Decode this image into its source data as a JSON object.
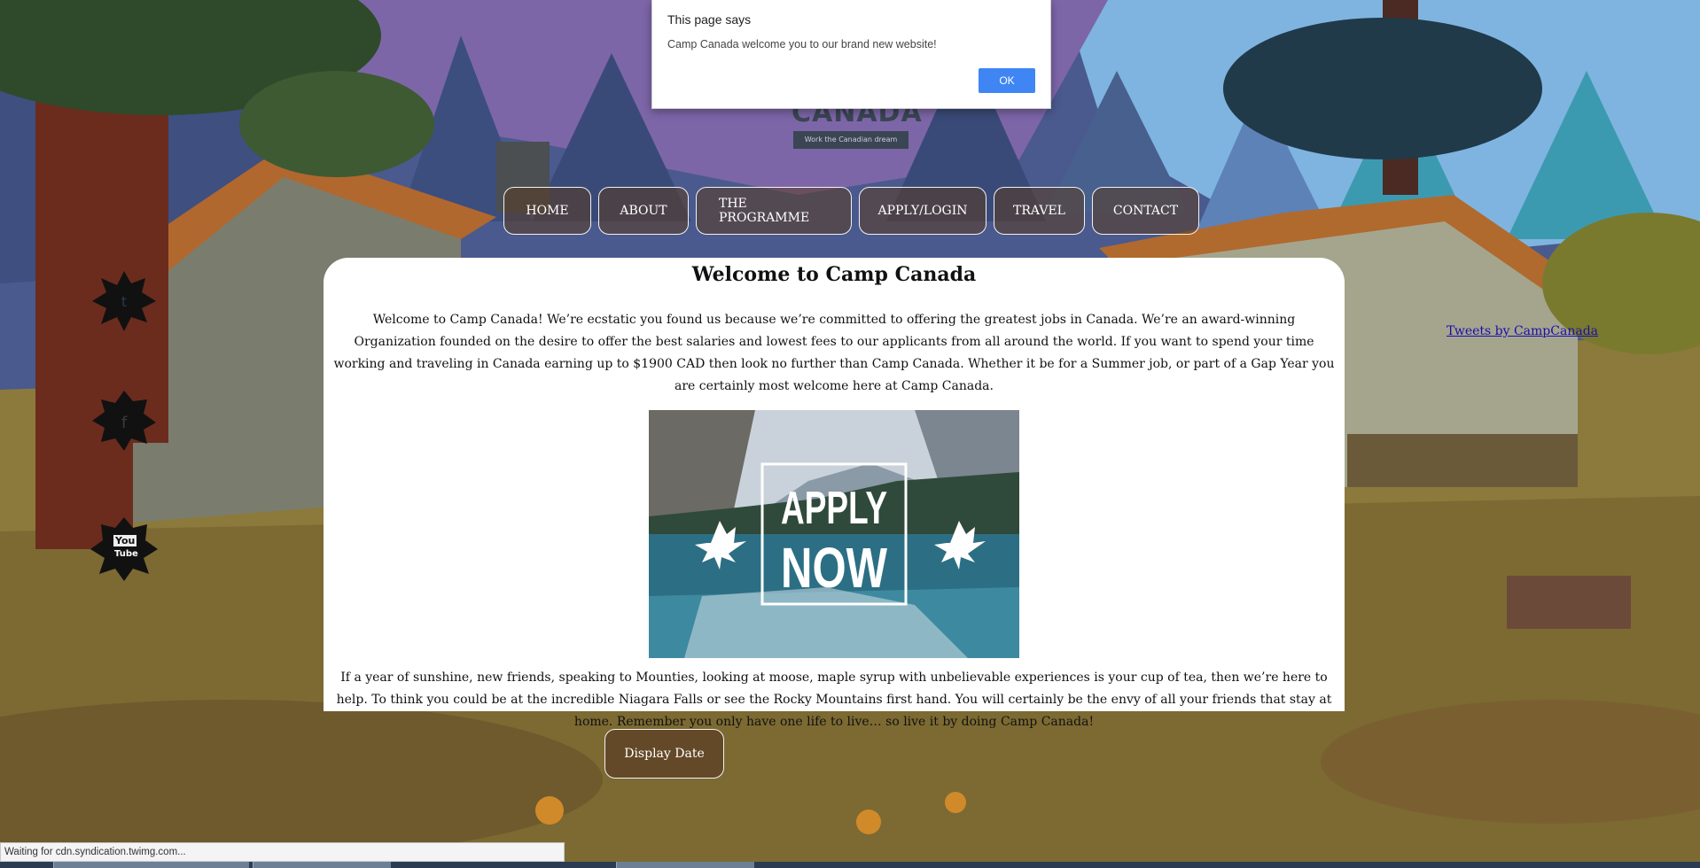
{
  "nav": {
    "items": [
      {
        "label": "HOME"
      },
      {
        "label": "ABOUT"
      },
      {
        "label": "THE PROGRAMME"
      },
      {
        "label": "APPLY/LOGIN"
      },
      {
        "label": "TRAVEL"
      },
      {
        "label": "CONTACT"
      }
    ]
  },
  "logo": {
    "word": "CANADA",
    "tagline": "Work the Canadian dream"
  },
  "main": {
    "title": "Welcome to Camp Canada",
    "intro": "Welcome to Camp Canada! We’re ecstatic you found us because we’re committed to offering the greatest jobs in Canada. We’re an award-winning Organization founded on the desire to offer the best salaries and lowest fees to our applicants from all around the world. If you want to spend your time working and traveling in Canada earning up to $1900 CAD then look no further than Camp Canada. Whether it be for a Summer job, or part of a Gap Year you are certainly most welcome here at Camp Canada.",
    "banner_line1": "APPLY",
    "banner_line2": "NOW",
    "outro": "If a year of sunshine, new friends, speaking to Mounties, looking at moose, maple syrup with unbelievable experiences is your cup of tea, then we’re here to help. To think you could be at the incredible Niagara Falls or see the Rocky Mountains first hand. You will certainly be the envy of all your friends that stay at home. Remember you only have one life to live… so live it by doing Camp Canada!"
  },
  "date_button": {
    "label": "Display Date"
  },
  "tweets": {
    "label": "Tweets by CampCanada"
  },
  "social": {
    "youtube_label": "You",
    "youtube_tube": "Tube"
  },
  "alert": {
    "title": "This page says",
    "message": "Camp Canada welcome you to our brand new website!",
    "ok_label": "OK",
    "ok_color": "#3f86f4"
  },
  "status_bar": {
    "text": "Waiting for cdn.syndication.twimg.com..."
  }
}
